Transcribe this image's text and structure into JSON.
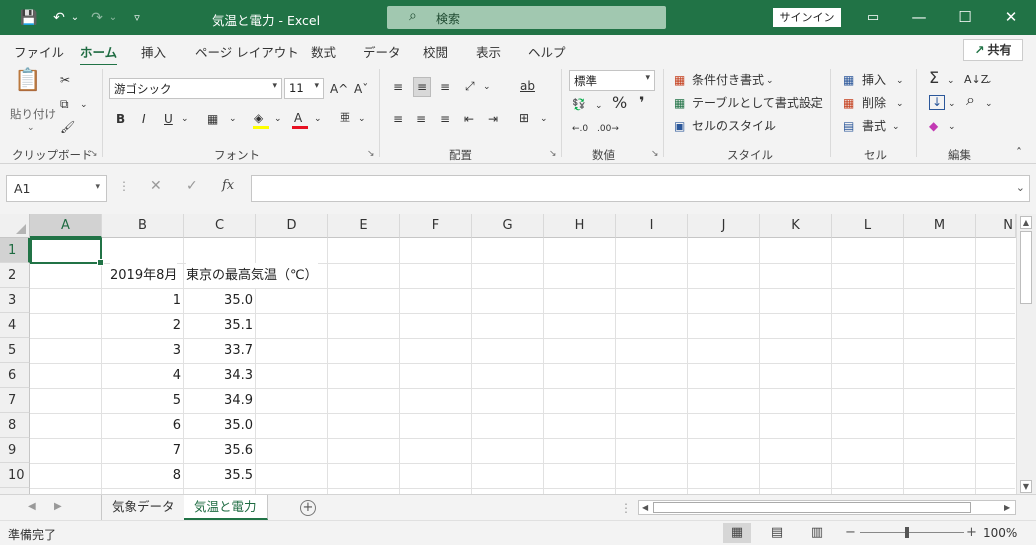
{
  "titlebar": {
    "title": "気温と電力  -  Excel",
    "search_icon": "search-icon",
    "search_text": "検索",
    "signin": "サインイン",
    "icons": {
      "save": "💾",
      "undo": "↶",
      "undo_dd": "⌄",
      "redo": "↷",
      "redo_dd": "⌄",
      "customize": "▿",
      "ribbon_display": "▭",
      "minimize": "—",
      "maximize": "☐",
      "close": "✕"
    }
  },
  "menu": {
    "tabs": [
      "ファイル",
      "ホーム",
      "挿入",
      "ページ レイアウト",
      "数式",
      "データ",
      "校閲",
      "表示",
      "ヘルプ"
    ],
    "active_tab": "ホーム",
    "share": "共有",
    "share_icon": "↗"
  },
  "ribbon": {
    "clipboard": {
      "label": "クリップボード",
      "paste": "貼り付け",
      "paste_dd": "⌄",
      "cut_icon": "✂",
      "copy_icon": "⧉",
      "copy_dd": "⌄",
      "brush_icon": "🖌"
    },
    "font": {
      "label": "フォント",
      "font_name": "游ゴシック",
      "font_size": "11",
      "grow": "A^",
      "shrink": "Aˇ",
      "bold": "B",
      "italic": "I",
      "underline": "U",
      "underline_dd": "⌄",
      "border": "▦",
      "border_dd": "⌄",
      "fill": "◈",
      "fill_dd": "⌄",
      "fill_color": "#ffff00",
      "font_color": "A",
      "font_color_dd": "⌄",
      "font_color_bar": "#e81123",
      "phonetic": "亜",
      "phonetic_dd": "⌄"
    },
    "alignment": {
      "label": "配置",
      "top": "≡",
      "middle": "≡",
      "bottom": "≡",
      "orientation": "⤢",
      "orientation_dd": "⌄",
      "wrap": "ab",
      "left": "≡",
      "center": "≡",
      "right": "≡",
      "dec_indent": "⇤",
      "inc_indent": "⇥",
      "merge": "⊞",
      "merge_dd": "⌄"
    },
    "number": {
      "label": "数値",
      "format": "標準",
      "currency": "💱",
      "currency_dd": "⌄",
      "percent": "%",
      "comma": "❜",
      "inc_dec": "←.0",
      "dec_dec": ".00→"
    },
    "styles": {
      "label": "スタイル",
      "conditional": "条件付き書式",
      "conditional_dd": "⌄",
      "as_table": "テーブルとして書式設定",
      "as_table_dd": "⌄",
      "cell_styles": "セルのスタイル",
      "cell_styles_dd": "⌄"
    },
    "cells": {
      "label": "セル",
      "insert": "挿入",
      "insert_dd": "⌄",
      "delete": "削除",
      "delete_dd": "⌄",
      "format": "書式",
      "format_dd": "⌄"
    },
    "editing": {
      "label": "編集",
      "sum": "Σ",
      "sum_dd": "⌄",
      "sort": "A↓Z",
      "sort_dd": "⌄",
      "fill": "↓",
      "fill_dd": "⌄",
      "find": "⌕",
      "find_dd": "⌄",
      "clear": "◆",
      "clear_dd": "⌄"
    },
    "collapse": "ˆ",
    "launcher": "↘"
  },
  "formula": {
    "name_box": "A1",
    "name_dd": "▾",
    "dots": "⋮",
    "cancel": "✕",
    "enter": "✓",
    "fx": "fx",
    "value": "",
    "expand": "⌄"
  },
  "grid": {
    "columns": [
      "A",
      "B",
      "C",
      "D",
      "E",
      "F",
      "G",
      "H",
      "I",
      "J",
      "K",
      "L",
      "M",
      "N"
    ],
    "rows": [
      "1",
      "2",
      "3",
      "4",
      "5",
      "6",
      "7",
      "8",
      "9",
      "10"
    ],
    "selected_col": "A",
    "selected_row": "1",
    "header_row": {
      "b": "2019年8月",
      "c": "東京の最高気温（℃）"
    },
    "data": [
      {
        "day": "1",
        "temp": "35.0"
      },
      {
        "day": "2",
        "temp": "35.1"
      },
      {
        "day": "3",
        "temp": "33.7"
      },
      {
        "day": "4",
        "temp": "34.3"
      },
      {
        "day": "5",
        "temp": "34.9"
      },
      {
        "day": "6",
        "temp": "35.0"
      },
      {
        "day": "7",
        "temp": "35.6"
      },
      {
        "day": "8",
        "temp": "35.5"
      }
    ]
  },
  "scroll": {
    "up": "▲",
    "down": "▼",
    "left": "◀",
    "right": "▶"
  },
  "sheets": {
    "tabs": [
      "気象データ",
      "気温と電力"
    ],
    "active": "気温と電力",
    "prev": "◀",
    "next": "▶",
    "add": "+",
    "dots": "⋮"
  },
  "status": {
    "text": "準備完了",
    "view_normal": "▦",
    "view_layout": "▤",
    "view_break": "▥",
    "zoom_minus": "−",
    "zoom_plus": "+",
    "zoom": "100%"
  }
}
